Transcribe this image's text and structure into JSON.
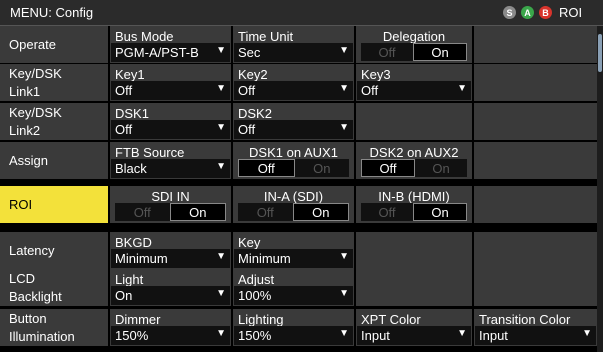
{
  "header": {
    "title": "MENU: Config",
    "badges": [
      "S",
      "A",
      "B"
    ],
    "roi": "ROI"
  },
  "rows": [
    {
      "label": "Operate",
      "cells": [
        {
          "type": "select",
          "label": "Bus Mode",
          "value": "PGM-A/PST-B"
        },
        {
          "type": "select",
          "label": "Time Unit",
          "value": "Sec"
        },
        {
          "type": "toggle",
          "label": "Delegation",
          "left": "Off",
          "right": "On",
          "active": "right"
        },
        {
          "type": "empty"
        }
      ]
    },
    {
      "label": "Key/DSK Link1",
      "cells": [
        {
          "type": "select",
          "label": "Key1",
          "value": "Off"
        },
        {
          "type": "select",
          "label": "Key2",
          "value": "Off"
        },
        {
          "type": "select",
          "label": "Key3",
          "value": "Off"
        },
        {
          "type": "empty"
        }
      ]
    },
    {
      "label": "Key/DSK Link2",
      "cells": [
        {
          "type": "select",
          "label": "DSK1",
          "value": "Off"
        },
        {
          "type": "select",
          "label": "DSK2",
          "value": "Off"
        },
        {
          "type": "empty"
        },
        {
          "type": "empty"
        }
      ]
    },
    {
      "label": "Assign",
      "cells": [
        {
          "type": "select",
          "label": "FTB Source",
          "value": "Black"
        },
        {
          "type": "toggle",
          "label": "DSK1 on AUX1",
          "left": "Off",
          "right": "On",
          "active": "left"
        },
        {
          "type": "toggle",
          "label": "DSK2 on AUX2",
          "left": "Off",
          "right": "On",
          "active": "left"
        },
        {
          "type": "empty"
        }
      ]
    },
    {
      "label": "ROI",
      "highlight": true,
      "cells": [
        {
          "type": "toggle",
          "label": "SDI IN",
          "left": "Off",
          "right": "On",
          "active": "right"
        },
        {
          "type": "toggle",
          "label": "IN-A (SDI)",
          "left": "Off",
          "right": "On",
          "active": "right"
        },
        {
          "type": "toggle",
          "label": "IN-B (HDMI)",
          "left": "Off",
          "right": "On",
          "active": "right"
        },
        {
          "type": "empty"
        }
      ]
    },
    {
      "label": "Latency",
      "cells": [
        {
          "type": "select",
          "label": "BKGD",
          "value": "Minimum"
        },
        {
          "type": "select",
          "label": "Key",
          "value": "Minimum"
        },
        {
          "type": "empty"
        },
        {
          "type": "empty"
        }
      ]
    },
    {
      "label": "LCD Backlight",
      "cells": [
        {
          "type": "select",
          "label": "Light",
          "value": "On"
        },
        {
          "type": "select",
          "label": "Adjust",
          "value": "100%"
        },
        {
          "type": "empty"
        },
        {
          "type": "empty"
        }
      ]
    },
    {
      "label": "Button Illumination",
      "cells": [
        {
          "type": "select",
          "label": "Dimmer",
          "value": "150%"
        },
        {
          "type": "select",
          "label": "Lighting",
          "value": "150%"
        },
        {
          "type": "select",
          "label": "XPT Color",
          "value": "Input"
        },
        {
          "type": "select",
          "label": "Transition Color",
          "value": "Input"
        }
      ]
    }
  ],
  "colors": {
    "badge_s": "#8a8a8a",
    "badge_a": "#3aa64a",
    "badge_b": "#d8342c",
    "highlight": "#f3e13a",
    "panel": "#3a3a3a"
  },
  "icons": {
    "dropdown": "triangle-down-icon"
  }
}
